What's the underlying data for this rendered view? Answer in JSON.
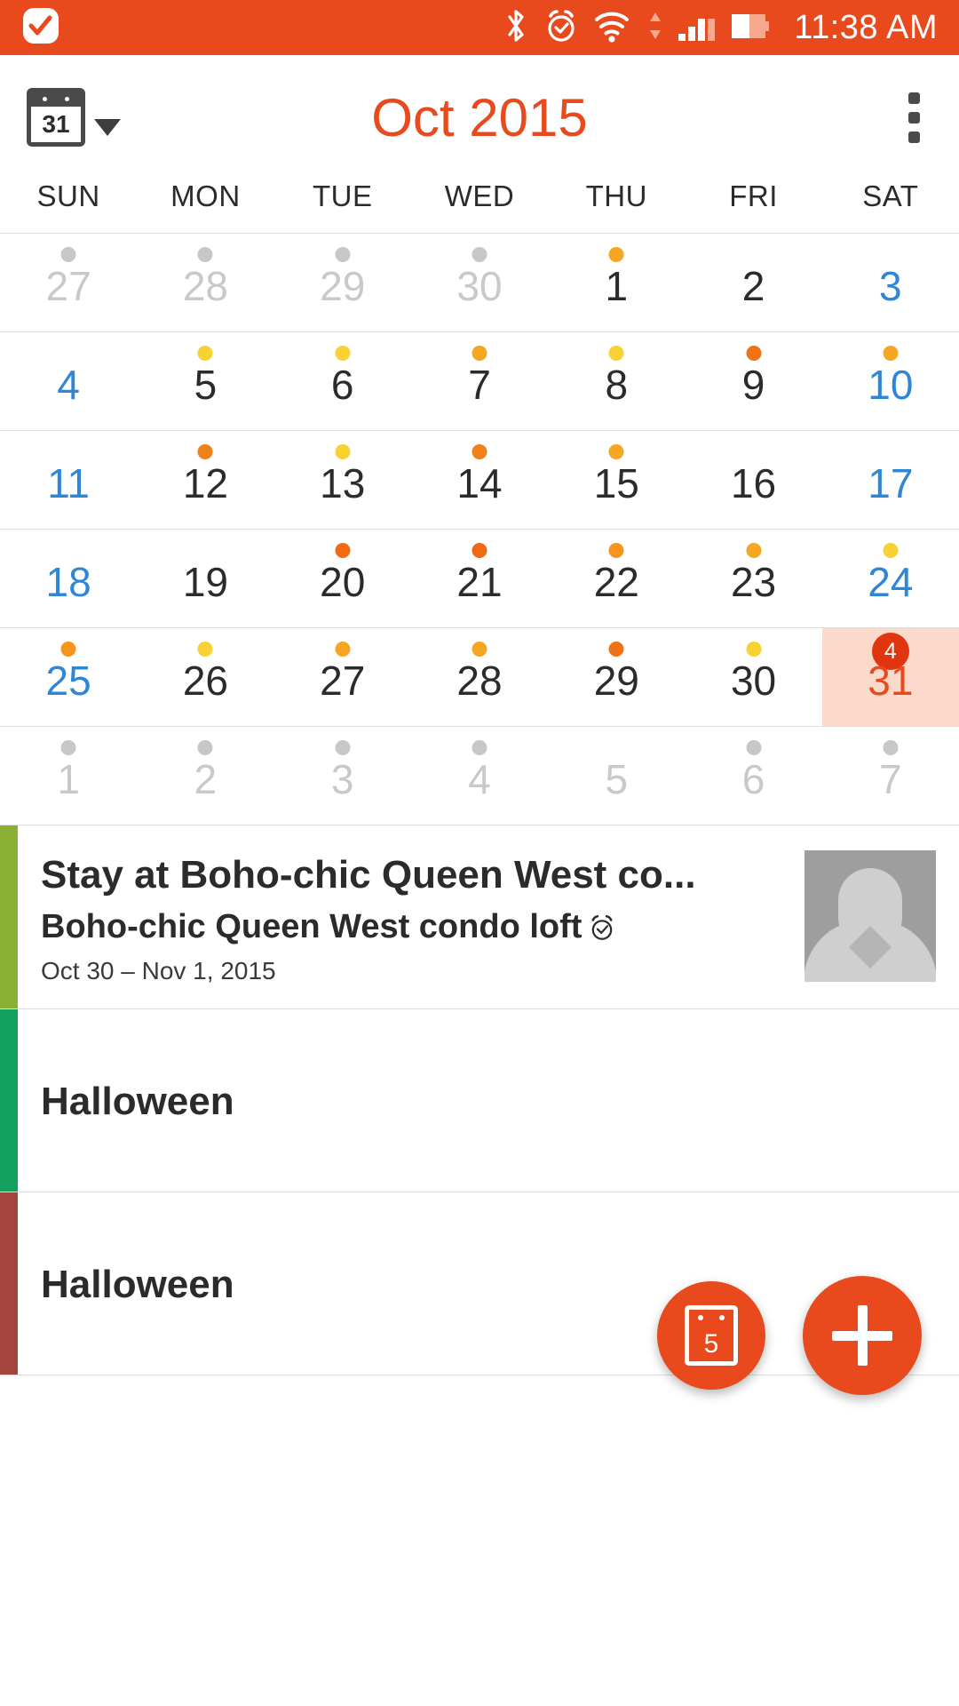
{
  "status_bar": {
    "time": "11:38 AM",
    "background_color": "#e8491d",
    "icons": [
      "notification-check-icon",
      "bluetooth-icon",
      "alarm-icon",
      "wifi-icon",
      "signal-icon",
      "battery-icon"
    ]
  },
  "app_bar": {
    "title": "Oct 2015",
    "title_color": "#e8491d",
    "calendar_view_day": "31",
    "view_switcher_name": "calendar-view-switcher",
    "overflow_name": "overflow-menu-button"
  },
  "calendar": {
    "weekday_headers": [
      "SUN",
      "MON",
      "TUE",
      "WED",
      "THU",
      "FRI",
      "SAT"
    ],
    "selected_day": "31",
    "selected_day_event_count": "4",
    "colors": {
      "weekend": "#2f86d6",
      "other_month": "#c9c9c9",
      "selected_bg": "#fbd9cb",
      "selected_text": "#e8491d",
      "badge": "#e0350e"
    },
    "weeks": [
      [
        {
          "day": "27",
          "other": true,
          "dot": "#c7c7c7"
        },
        {
          "day": "28",
          "other": true,
          "dot": "#c7c7c7"
        },
        {
          "day": "29",
          "other": true,
          "dot": "#c7c7c7"
        },
        {
          "day": "30",
          "other": true,
          "dot": "#c7c7c7"
        },
        {
          "day": "1",
          "dot": "#f5a623"
        },
        {
          "day": "2",
          "dot": null
        },
        {
          "day": "3",
          "weekend": true,
          "dot": null
        }
      ],
      [
        {
          "day": "4",
          "weekend": true,
          "dot": null
        },
        {
          "day": "5",
          "dot": "#f8d133"
        },
        {
          "day": "6",
          "dot": "#f8d133"
        },
        {
          "day": "7",
          "dot": "#f5a623"
        },
        {
          "day": "8",
          "dot": "#f8d133"
        },
        {
          "day": "9",
          "dot": "#ef7215"
        },
        {
          "day": "10",
          "weekend": true,
          "dot": "#f5a623"
        }
      ],
      [
        {
          "day": "11",
          "weekend": true,
          "dot": null
        },
        {
          "day": "12",
          "dot": "#f08019"
        },
        {
          "day": "13",
          "dot": "#f8d133"
        },
        {
          "day": "14",
          "dot": "#f08019"
        },
        {
          "day": "15",
          "dot": "#f5a623"
        },
        {
          "day": "16",
          "dot": null
        },
        {
          "day": "17",
          "weekend": true,
          "dot": null
        }
      ],
      [
        {
          "day": "18",
          "weekend": true,
          "dot": null
        },
        {
          "day": "19",
          "dot": null
        },
        {
          "day": "20",
          "dot": "#ef6a13"
        },
        {
          "day": "21",
          "dot": "#ef6a13"
        },
        {
          "day": "22",
          "dot": "#f5951e"
        },
        {
          "day": "23",
          "dot": "#f5a623"
        },
        {
          "day": "24",
          "weekend": true,
          "dot": "#f8d133"
        }
      ],
      [
        {
          "day": "25",
          "weekend": true,
          "dot": "#f5951e"
        },
        {
          "day": "26",
          "dot": "#f8d133"
        },
        {
          "day": "27",
          "dot": "#f5a623"
        },
        {
          "day": "28",
          "dot": "#f5a623"
        },
        {
          "day": "29",
          "dot": "#ef7215"
        },
        {
          "day": "30",
          "dot": "#f8d133"
        },
        {
          "day": "31",
          "weekend": true,
          "selected": true,
          "badge": "4"
        }
      ],
      [
        {
          "day": "1",
          "other": true,
          "dot": "#c7c7c7"
        },
        {
          "day": "2",
          "other": true,
          "dot": "#c7c7c7"
        },
        {
          "day": "3",
          "other": true,
          "dot": "#c7c7c7"
        },
        {
          "day": "4",
          "other": true,
          "dot": "#c7c7c7"
        },
        {
          "day": "5",
          "other": true,
          "dot": null
        },
        {
          "day": "6",
          "other": true,
          "dot": "#c7c7c7"
        },
        {
          "day": "7",
          "other": true,
          "dot": "#c7c7c7"
        }
      ]
    ]
  },
  "event_list": [
    {
      "stripe_color": "#8ab034",
      "title": "Stay at Boho-chic Queen West co...",
      "subtitle": "Boho-chic Queen West condo loft",
      "has_alarm": true,
      "date_range": "Oct 30 – Nov 1, 2015",
      "has_thumbnail": true
    },
    {
      "stripe_color": "#12a05c",
      "title": "Halloween",
      "subtitle": "",
      "has_alarm": false,
      "date_range": "",
      "has_thumbnail": false
    },
    {
      "stripe_color": "#a3453e",
      "title": "Halloween",
      "subtitle": "",
      "has_alarm": false,
      "date_range": "",
      "has_thumbnail": false
    }
  ],
  "fab": {
    "today_label": "5",
    "today_name": "today-fab",
    "add_name": "add-event-fab",
    "color": "#e8491d"
  }
}
